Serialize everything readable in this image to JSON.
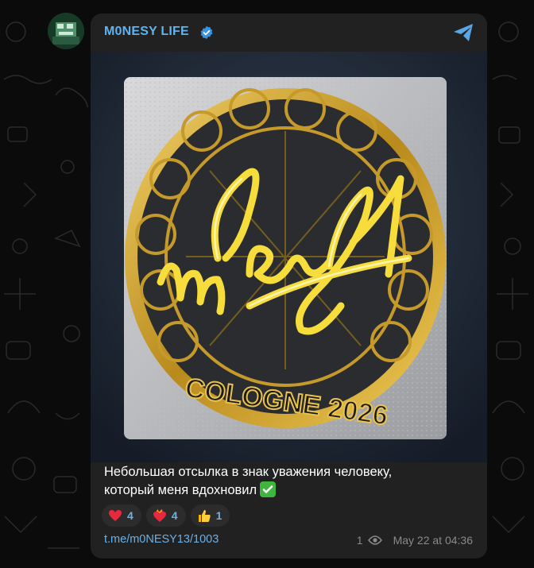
{
  "channel": {
    "name": "M0NESY LIFE",
    "verified": true
  },
  "post": {
    "sticker_signature": "m0NESY",
    "sticker_event": "COLOGNE 2026",
    "caption_line1": "Небольшая отсылка в знак уважения человеку,",
    "caption_line2": "который меня вдохновил",
    "reactions": [
      {
        "icon": "red-heart",
        "count": "4"
      },
      {
        "icon": "heart-on-fire",
        "count": "4"
      },
      {
        "icon": "thumbs-up",
        "count": "1"
      }
    ],
    "link": "t.me/m0NESY13/1003",
    "views": "1",
    "date": "May 22 at 04:36"
  },
  "colors": {
    "background": "#0b0b0b",
    "card": "#212121",
    "accent": "#60b3ee",
    "gold": "#d4a82a"
  }
}
